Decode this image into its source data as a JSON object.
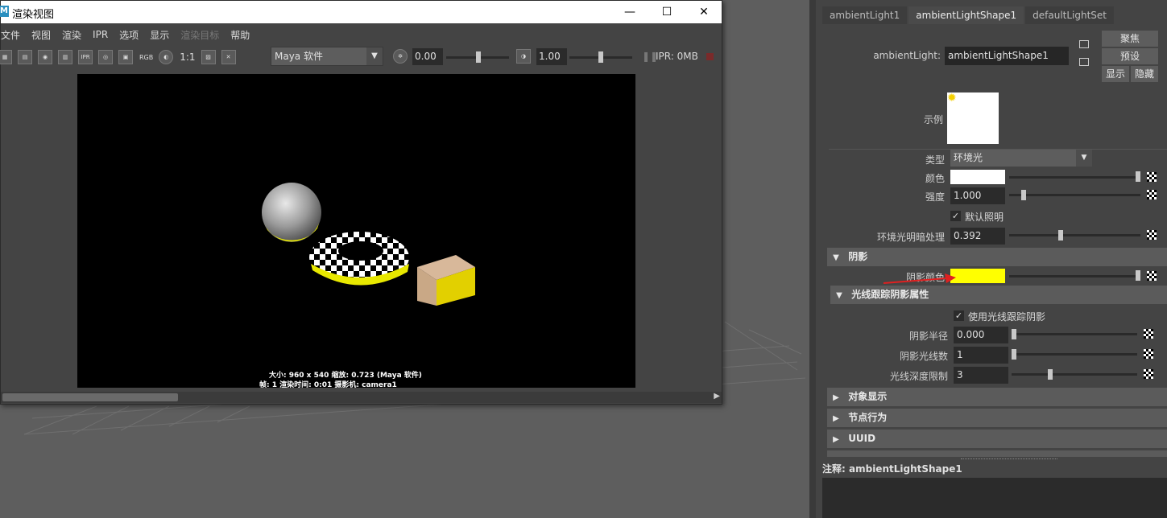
{
  "render_view": {
    "title": "渲染视图",
    "menu": [
      "文件",
      "视图",
      "渲染",
      "IPR",
      "选项",
      "显示",
      "渲染目标",
      "帮助"
    ],
    "menu_disabled": [
      "渲染目标"
    ],
    "toolbar": {
      "rgb_label": "RGB",
      "ratio_label": "1:1",
      "renderer": "Maya 软件",
      "exposure": "0.00",
      "gamma": "1.00",
      "ipr_memory": "IPR: 0MB"
    },
    "render_info": {
      "line1": "大小: 960 x 540  缩放: 0.723        (Maya 软件)",
      "line2": "帧: 1       渲染时间: 0:01       摄影机: camera1"
    }
  },
  "attribute_editor": {
    "tabs": [
      "ambientLight1",
      "ambientLightShape1",
      "defaultLightSet"
    ],
    "active_tab": "ambientLightShape1",
    "node_label": "ambientLight:",
    "node_name": "ambientLightShape1",
    "buttons": {
      "focus": "聚焦",
      "presets": "预设",
      "show": "显示",
      "hide": "隐藏"
    },
    "sample_label": "示例",
    "type_label": "类型",
    "type_value": "环境光",
    "color_label": "颜色",
    "color_value": "#ffffff",
    "intensity_label": "强度",
    "intensity_value": "1.000",
    "default_lighting_label": "默认照明",
    "ambient_shade_label": "环境光明暗处理",
    "ambient_shade_value": "0.392",
    "shadows_section": "阴影",
    "shadow_color_label": "阴影颜色",
    "shadow_color_value": "#ffff00",
    "raytrace_section": "光线跟踪阴影属性",
    "use_raytrace_label": "使用光线跟踪阴影",
    "shadow_radius_label": "阴影半径",
    "shadow_radius_value": "0.000",
    "shadow_rays_label": "阴影光线数",
    "shadow_rays_value": "1",
    "ray_depth_label": "光线深度限制",
    "ray_depth_value": "3",
    "collapsed_sections": [
      "对象显示",
      "节点行为",
      "UUID"
    ],
    "notes_label": "注释:",
    "notes_value": "ambientLightShape1"
  },
  "colors": {
    "highlight_arrow": "#e02020",
    "shadow_yellow": "#ffff00"
  }
}
